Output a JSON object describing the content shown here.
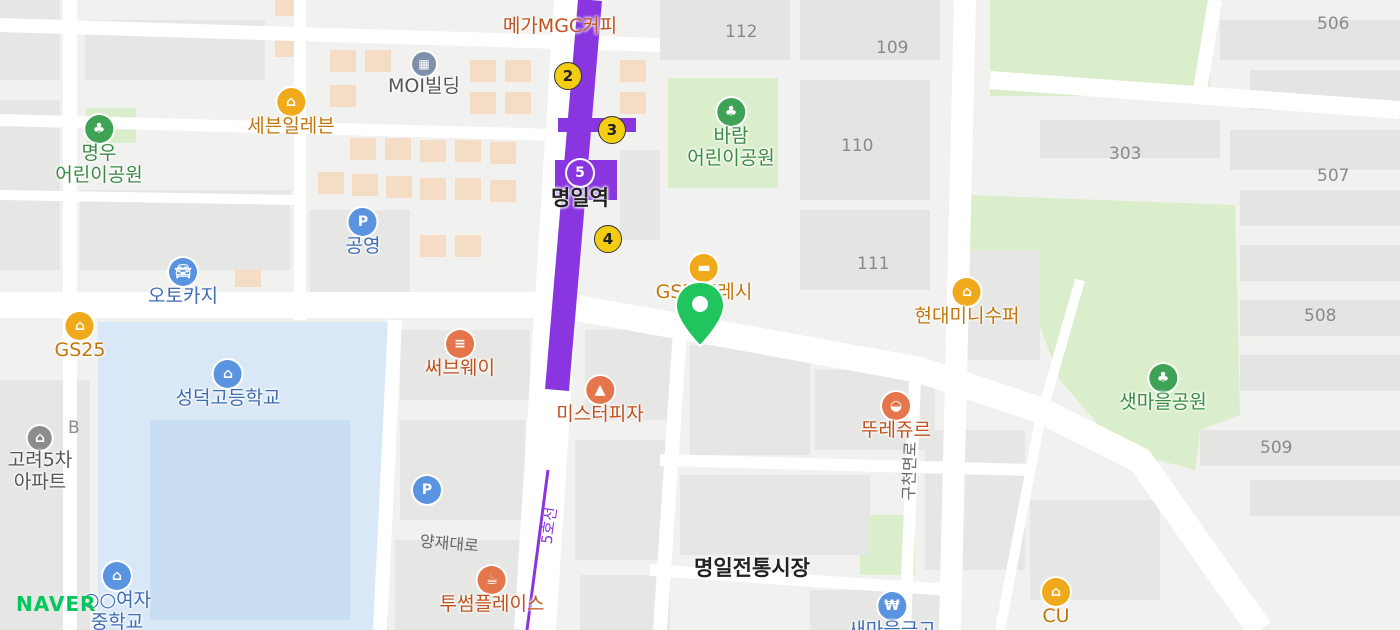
{
  "map": {
    "logo": "NAVER",
    "station": {
      "name": "명일역",
      "line_number": "5",
      "line_label": "5호선",
      "exits": [
        "2",
        "3",
        "4"
      ]
    },
    "pois": {
      "megamgc": "메가MGC커피",
      "moi": "MOI빌딩",
      "seven": "세븐일레븐",
      "myeongwoo_park": "명우\n어린이공원",
      "public_parking": "공영",
      "otokaji": "오토카지",
      "gs25": "GS25",
      "seongdeok": "성덕고등학교",
      "goryeo": "고려5차\n아파트",
      "subway": "써브웨이",
      "mister_pizza": "미스터피자",
      "baram_park": "바람\n어린이공원",
      "gs_fresh": "GS더프레시",
      "hyundai": "현대미니수퍼",
      "touslesjours": "뚜레쥬르",
      "saetmaeul": "샛마을공원",
      "market": "명일전통시장",
      "twosome": "투썸플레이스",
      "girls_school": "○○여자\n중학교",
      "cu": "CU",
      "bank": "새마을금고"
    },
    "building_numbers": [
      "112",
      "109",
      "110",
      "111",
      "303",
      "506",
      "507",
      "508",
      "509",
      "B"
    ],
    "roads": [
      "양재대로",
      "구천면로"
    ],
    "colors": {
      "line5": "#8936e0",
      "park": "#dbeecb",
      "school": "#d9e8f6",
      "marker": "#21c55d",
      "poi_orange": "#f0a91b"
    }
  }
}
